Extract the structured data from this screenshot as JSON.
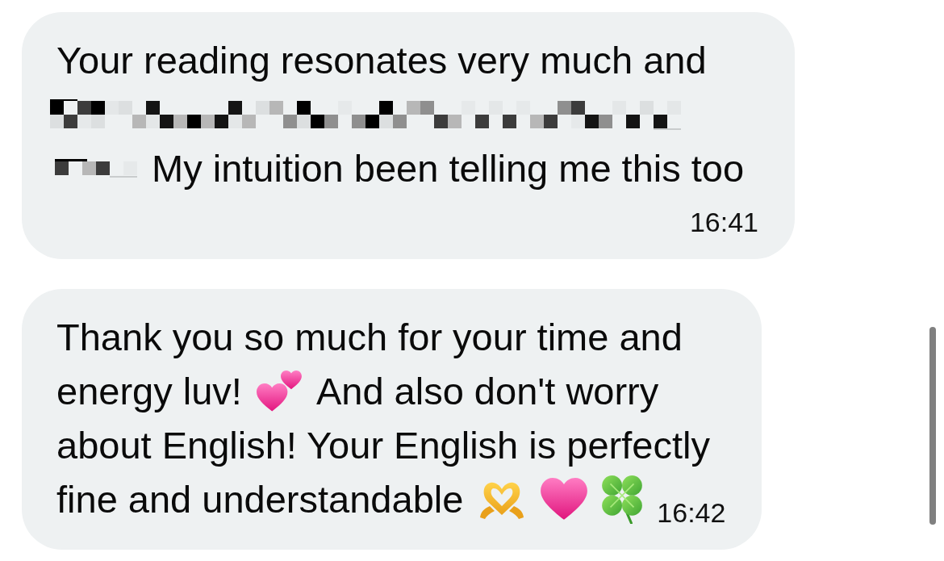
{
  "messages": [
    {
      "lines": [
        [
          {
            "kind": "text",
            "text": "Your reading resonates very much and"
          }
        ],
        [
          {
            "kind": "redacted"
          }
        ],
        [
          {
            "kind": "redacted"
          },
          {
            "kind": "text",
            "text": "My intuition been telling me this too"
          }
        ]
      ],
      "time": "16:41"
    },
    {
      "lines": [
        [
          {
            "kind": "text",
            "text": "Thank you so much for your time and"
          }
        ],
        [
          {
            "kind": "text",
            "text": "energy luv!"
          },
          {
            "kind": "emoji"
          },
          {
            "kind": "text",
            "text": "And also don't worry"
          }
        ],
        [
          {
            "kind": "text",
            "text": "about English! Your English is perfectly"
          }
        ],
        [
          {
            "kind": "text",
            "text": "fine and understandable"
          },
          {
            "kind": "emoji"
          },
          {
            "kind": "emoji"
          },
          {
            "kind": "emoji"
          }
        ]
      ],
      "time": "16:42"
    }
  ]
}
